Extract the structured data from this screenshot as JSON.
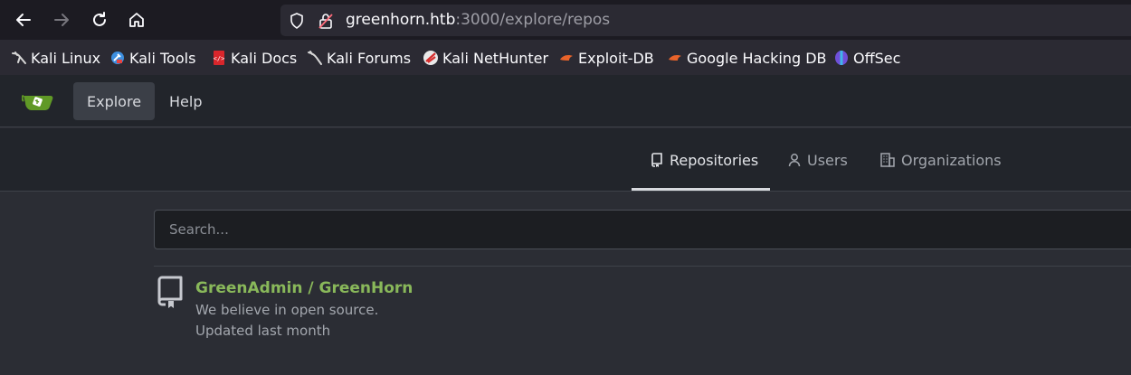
{
  "browser": {
    "url_host": "greenhorn.htb",
    "url_path": ":3000/explore/repos",
    "bookmarks": [
      {
        "label": "Kali Linux",
        "icon": "kali-dragon-icon"
      },
      {
        "label": "Kali Tools",
        "icon": "kali-tools-icon"
      },
      {
        "label": "Kali Docs",
        "icon": "kali-docs-icon"
      },
      {
        "label": "Kali Forums",
        "icon": "kali-dragon-icon"
      },
      {
        "label": "Kali NetHunter",
        "icon": "nethunter-icon"
      },
      {
        "label": "Exploit-DB",
        "icon": "exploitdb-icon"
      },
      {
        "label": "Google Hacking DB",
        "icon": "exploitdb-icon"
      },
      {
        "label": "OffSec",
        "icon": "offsec-icon"
      }
    ]
  },
  "header": {
    "logo": "gitea-logo-icon",
    "explore_label": "Explore",
    "help_label": "Help"
  },
  "tabs": {
    "repositories": "Repositories",
    "users": "Users",
    "organizations": "Organizations"
  },
  "search": {
    "placeholder": "Search..."
  },
  "repos": [
    {
      "name": "GreenAdmin / GreenHorn",
      "description": "We believe in open source.",
      "updated": "Updated last month"
    }
  ],
  "colors": {
    "accent_green": "#89b85a",
    "background": "#2b2d34",
    "header_bg": "#22252b"
  }
}
